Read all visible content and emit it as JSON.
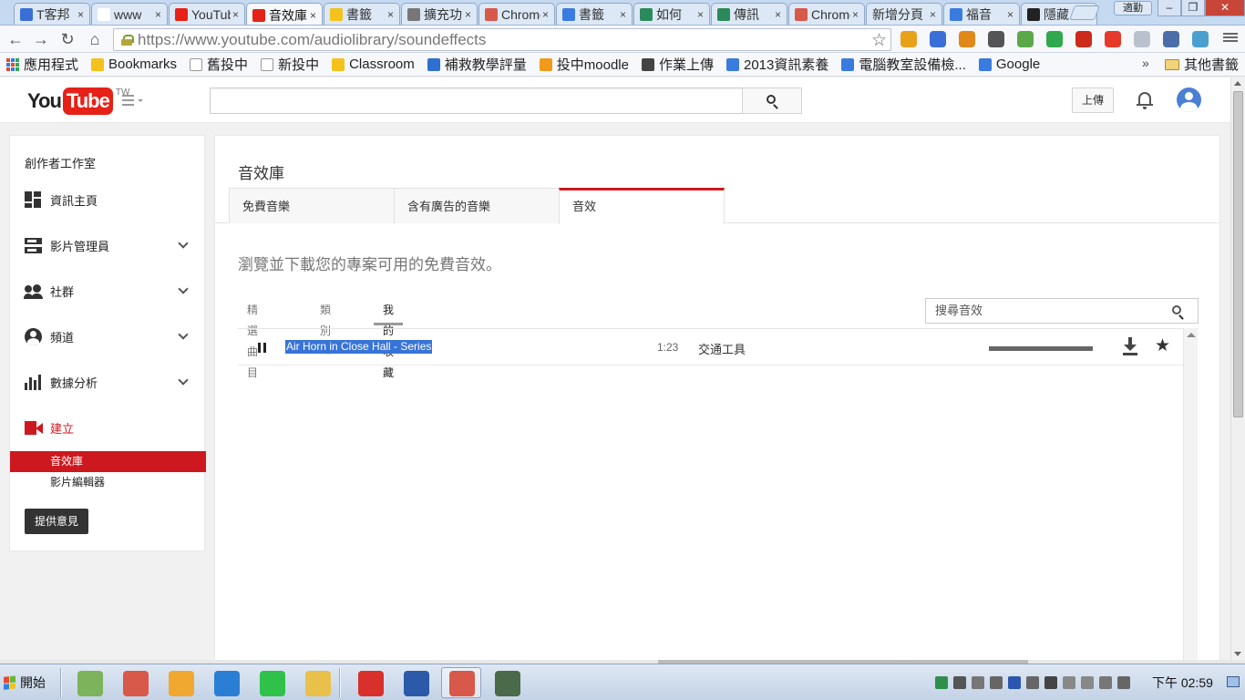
{
  "browser": {
    "tabs": [
      {
        "title": "T客邦",
        "favicon_color": "#3a6fd8"
      },
      {
        "title": "www",
        "favicon_color": "#ffffff"
      },
      {
        "title": "YouTube",
        "favicon_color": "#e62117"
      },
      {
        "title": "音效庫",
        "favicon_color": "#e62117",
        "active": true
      },
      {
        "title": "書籤",
        "favicon_color": "#f4c21a"
      },
      {
        "title": "擴充功能",
        "favicon_color": "#777777"
      },
      {
        "title": "Chrome",
        "favicon_color": "#d8584a"
      },
      {
        "title": "書籤",
        "favicon_color": "#3a7be0"
      },
      {
        "title": "如何",
        "favicon_color": "#2b8a5a"
      },
      {
        "title": "傳訊",
        "favicon_color": "#2b8a5a"
      },
      {
        "title": "Chrome",
        "favicon_color": "#d8584a"
      },
      {
        "title": "新增分頁",
        "favicon_color": ""
      },
      {
        "title": "福音",
        "favicon_color": "#3a7be0"
      },
      {
        "title": "隱藏",
        "favicon_color": "#222222"
      }
    ],
    "tab_close": "×",
    "profile_label": "適勤",
    "window_controls": {
      "minimize": "–",
      "maximize": "❐",
      "close": "✕"
    },
    "nav": {
      "back": "←",
      "forward": "→",
      "reload": "↻",
      "home": "⌂"
    },
    "url_prefix": "https://www.youtube.com",
    "url_path": "/audiolibrary/soundeffects",
    "star_glyph": "☆",
    "extensions": [
      "#e8a21a",
      "#3a6fd8",
      "#e2881a",
      "#555555",
      "#5aa84a",
      "#2fa84f",
      "#cc2a1a",
      "#e63a2a",
      "#b9c2cc",
      "#4c6ea8",
      "#4a9fcf"
    ]
  },
  "bookmarks": {
    "items": [
      {
        "label": "應用程式",
        "icon": "apps-grid"
      },
      {
        "label": "Bookmarks",
        "icon": "star-icon",
        "color": "#f4c21a"
      },
      {
        "label": "舊投中",
        "icon": "page-icon",
        "color": "#ffffff"
      },
      {
        "label": "新投中",
        "icon": "page-icon",
        "color": "#ffffff"
      },
      {
        "label": "Classroom",
        "icon": "classroom-icon",
        "color": "#f4c21a"
      },
      {
        "label": "補救教學評量",
        "icon": "tc-icon",
        "color": "#2f6fd0"
      },
      {
        "label": "投中moodle",
        "icon": "moodle-icon",
        "color": "#f29a1a"
      },
      {
        "label": "作業上傳",
        "icon": "upload-icon",
        "color": "#444444"
      },
      {
        "label": "2013資訊素養",
        "icon": "doc-icon",
        "color": "#3a7be0"
      },
      {
        "label": "電腦教室設備檢...",
        "icon": "doc-icon",
        "color": "#3a7be0"
      },
      {
        "label": "Google",
        "icon": "google-icon",
        "color": "#3a7be0"
      }
    ],
    "more": "»",
    "other_label": "其他書籤"
  },
  "youtube": {
    "logo_you": "You",
    "logo_tube": "Tube",
    "logo_region": "TW",
    "search_value": "",
    "upload_label": "上傳"
  },
  "sidebar": {
    "title": "創作者工作室",
    "items": [
      {
        "label": "資訊主頁",
        "expandable": false
      },
      {
        "label": "影片管理員",
        "expandable": true
      },
      {
        "label": "社群",
        "expandable": true
      },
      {
        "label": "頻道",
        "expandable": true
      },
      {
        "label": "數據分析",
        "expandable": true
      },
      {
        "label": "建立",
        "expandable": false,
        "accent": "#cc181e"
      }
    ],
    "create_sub": [
      {
        "label": "音效庫",
        "selected": true
      },
      {
        "label": "影片編輯器",
        "selected": false
      }
    ],
    "feedback_label": "提供意見"
  },
  "library": {
    "title": "音效庫",
    "tabs": [
      {
        "label": "免費音樂",
        "active": false
      },
      {
        "label": "含有廣告的音樂",
        "active": false
      },
      {
        "label": "音效",
        "active": true
      }
    ],
    "intro": "瀏覽並下載您的專案可用的免費音效。",
    "subtabs": [
      {
        "label": "精選曲目",
        "active": false
      },
      {
        "label": "類別",
        "active": false,
        "dropdown": true
      },
      {
        "label": "我的收藏",
        "active": true
      }
    ],
    "search_placeholder": "搜尋音效",
    "tracks": [
      {
        "title": "Air Horn in Close Hall - Series",
        "duration": "1:23",
        "category": "交通工具",
        "playing": true,
        "selected_text": true,
        "starred": true,
        "progress": 1.0
      }
    ],
    "star_glyph": "★"
  },
  "taskbar": {
    "start_label": "開始",
    "apps": [
      {
        "name": "box-app",
        "color": "#7db35a",
        "active": false
      },
      {
        "name": "chrome-app",
        "color": "#d8584a",
        "active": false
      },
      {
        "name": "search-app",
        "color": "#f0a830",
        "active": false
      },
      {
        "name": "teamviewer-app",
        "color": "#2a7fd4",
        "active": false
      },
      {
        "name": "line-app",
        "color": "#2fc14a",
        "active": false
      },
      {
        "name": "explorer-app",
        "color": "#e8c04a",
        "active": false
      },
      {
        "name": "xmind-app",
        "color": "#d8302a",
        "active": false
      },
      {
        "name": "word-app",
        "color": "#2b5aa8",
        "active": false
      },
      {
        "name": "chrome-app-active",
        "color": "#d8584a",
        "active": true
      },
      {
        "name": "monitor-app",
        "color": "#4a6a4a",
        "active": false
      }
    ],
    "tray_icons": [
      "#2f8f4a",
      "#555555",
      "#777777",
      "#666666",
      "#2a56b0",
      "#666666",
      "#444444",
      "#888888",
      "#888888",
      "#777777",
      "#666666"
    ],
    "clock": "下午 02:59"
  }
}
